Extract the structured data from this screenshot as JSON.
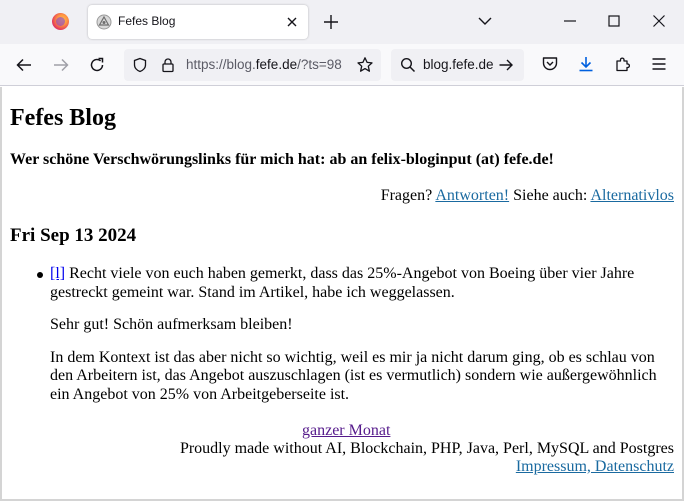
{
  "browser": {
    "tab": {
      "title": "Fefes Blog"
    },
    "url": {
      "prefix": "https://blog.",
      "domain": "fefe.de",
      "suffix": "/?ts=98"
    },
    "search": {
      "text": "blog.fefe.de"
    }
  },
  "page": {
    "title": "Fefes Blog",
    "subtitle": "Wer schöne Verschwörungslinks für mich hat: ab an felix-bloginput (at) fefe.de!",
    "fragen": {
      "prefix": "Fragen?",
      "answers_link": "Antworten!",
      "middle": "Siehe auch:",
      "alt_link": "Alternativlos"
    },
    "date": "Fri Sep 13 2024",
    "post": {
      "permalink": "[l]",
      "paragraph1": "Recht viele von euch haben gemerkt, dass das 25%-Angebot von Boeing über vier Jahre gestreckt gemeint war. Stand im Artikel, habe ich weggelassen.",
      "paragraph2": "Sehr gut! Schön aufmerksam bleiben!",
      "paragraph3": "In dem Kontext ist das aber nicht so wichtig, weil es mir ja nicht darum ging, ob es schlau von den Arbeitern ist, das Angebot auszuschlagen (ist es vermutlich) sondern wie außergewöhnlich ein Angebot von 25% von Arbeitgeberseite ist."
    },
    "footer": {
      "month_link": "ganzer Monat",
      "proudly": "Proudly made without AI, Blockchain, PHP, Java, Perl, MySQL and Postgres",
      "impressum_link": "Impressum, Datenschutz"
    }
  },
  "colors": {
    "link": "#0000ee",
    "link_visited": "#551a8b",
    "link_teal": "#1a6aa0",
    "download_accent": "#0060df"
  }
}
